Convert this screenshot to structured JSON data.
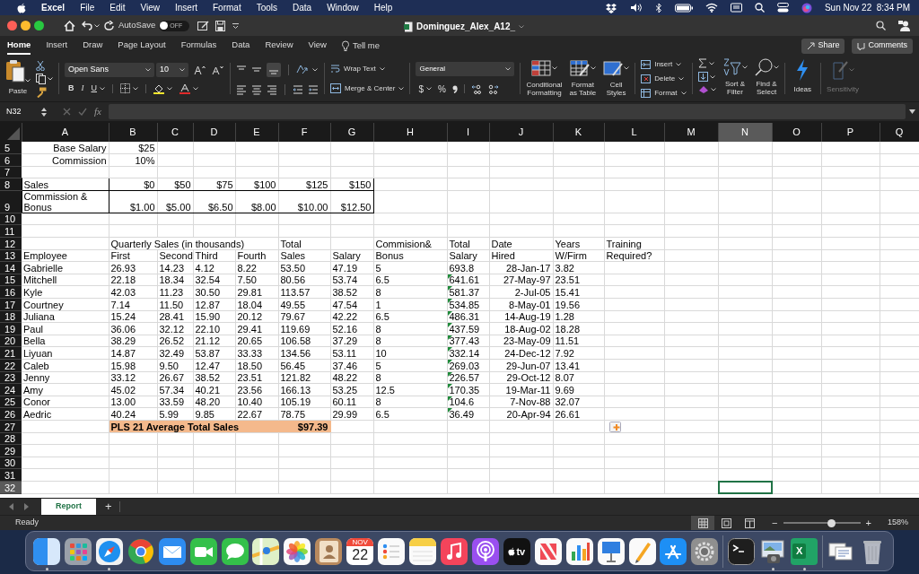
{
  "menu_bar": {
    "app": "Excel",
    "items": [
      "File",
      "Edit",
      "View",
      "Insert",
      "Format",
      "Tools",
      "Data",
      "Window",
      "Help"
    ],
    "clock": "Sun Nov 22  8:34 PM"
  },
  "title_bar": {
    "autosave": "AutoSave",
    "autosave_state": "OFF",
    "autosave_on": false,
    "document": "Dominguez_Alex_A12_"
  },
  "ribbon_tabs": [
    {
      "label": "Home",
      "selected": true
    },
    {
      "label": "Insert",
      "selected": false
    },
    {
      "label": "Draw",
      "selected": false
    },
    {
      "label": "Page Layout",
      "selected": false
    },
    {
      "label": "Formulas",
      "selected": false
    },
    {
      "label": "Data",
      "selected": false
    },
    {
      "label": "Review",
      "selected": false
    },
    {
      "label": "View",
      "selected": false
    }
  ],
  "tell_me": "Tell me",
  "share": "Share",
  "comments": "Comments",
  "ribbon": {
    "paste": "Paste",
    "font": "Open Sans",
    "size": "10",
    "bold": "B",
    "italic": "I",
    "underline": "U",
    "wrap": "Wrap Text",
    "merge": "Merge & Center",
    "number_format": "General",
    "currency": "$",
    "percent": "%",
    "styles": [
      "Conditional\nFormatting",
      "Format\nas Table",
      "Cell\nStyles"
    ],
    "cells": [
      "Insert",
      "Delete",
      "Format"
    ],
    "sort": "Sort &\nFilter",
    "find": "Find &\nSelect",
    "ideas": "Ideas",
    "sensitivity": "Sensitivity",
    "sensitivity_disabled": true
  },
  "formula_bar": {
    "name_box": "N32",
    "fx": "fx"
  },
  "columns": [
    {
      "label": "A",
      "selected": false
    },
    {
      "label": "B",
      "selected": false
    },
    {
      "label": "C",
      "selected": false
    },
    {
      "label": "D",
      "selected": false
    },
    {
      "label": "E",
      "selected": false
    },
    {
      "label": "F",
      "selected": false
    },
    {
      "label": "G",
      "selected": false
    },
    {
      "label": "H",
      "selected": false
    },
    {
      "label": "I",
      "selected": false
    },
    {
      "label": "J",
      "selected": false
    },
    {
      "label": "K",
      "selected": false
    },
    {
      "label": "L",
      "selected": false
    },
    {
      "label": "M",
      "selected": false
    },
    {
      "label": "N",
      "selected": true
    },
    {
      "label": "O",
      "selected": false
    },
    {
      "label": "P",
      "selected": false
    },
    {
      "label": "Q",
      "selected": false
    }
  ],
  "rows": [
    {
      "number": "5",
      "selected": false,
      "kind": "plain",
      "cells": [
        {
          "text": "Base Salary",
          "kind": "number"
        },
        {
          "text": "$25",
          "kind": "number"
        }
      ]
    },
    {
      "number": "6",
      "selected": false,
      "kind": "plain",
      "cells": [
        {
          "text": "Commission",
          "kind": "number"
        },
        {
          "text": "10%",
          "kind": "number"
        }
      ]
    },
    {
      "number": "7",
      "selected": false,
      "kind": "plain"
    },
    {
      "number": "8",
      "selected": false,
      "kind": "boxed",
      "cells": [
        "Sales",
        {
          "text": "$0",
          "kind": "number"
        },
        {
          "text": "$50",
          "kind": "number"
        },
        {
          "text": "$75",
          "kind": "number"
        },
        {
          "text": "$100",
          "kind": "number"
        },
        {
          "text": "$125",
          "kind": "number"
        },
        {
          "text": "$150",
          "kind": "number"
        }
      ]
    },
    {
      "number": "9",
      "selected": false,
      "kind": "boxed",
      "cells": [
        "Commission &\nBonus",
        {
          "text": "$1.00",
          "kind": "number"
        },
        {
          "text": "$5.00",
          "kind": "number"
        },
        {
          "text": "$6.50",
          "kind": "number"
        },
        {
          "text": "$8.00",
          "kind": "number"
        },
        {
          "text": "$10.00",
          "kind": "number"
        },
        {
          "text": "$12.50",
          "kind": "number"
        }
      ]
    },
    {
      "number": "10",
      "selected": false,
      "kind": "plain"
    },
    {
      "number": "11",
      "selected": false,
      "kind": "plain"
    },
    {
      "number": "12",
      "selected": false,
      "kind": "plain",
      "cells": [
        null,
        "Quarterly Sales (in thousands)",
        null,
        null,
        null,
        "Total",
        null,
        "Commision&",
        "Total",
        "Date",
        "Years",
        "Training"
      ]
    },
    {
      "number": "13",
      "selected": false,
      "kind": "plain",
      "cells": [
        "Employee",
        "First",
        "Second",
        "Third",
        "Fourth",
        "Sales",
        "Salary",
        "Bonus",
        "Salary",
        "Hired",
        "W/Firm",
        "Required?"
      ]
    },
    {
      "number": "14",
      "selected": false,
      "kind": "plain",
      "cells": [
        "Gabrielle",
        "26.93",
        "14.23",
        "4.12",
        "8.22",
        "53.50",
        "47.19",
        "5",
        "693.8",
        {
          "text": "28-Jan-17",
          "kind": "number"
        },
        "3.82"
      ]
    },
    {
      "number": "15",
      "selected": false,
      "kind": "plain",
      "cells": [
        "Mitchell",
        "22.18",
        "18.34",
        "32.54",
        "7.50",
        "80.56",
        "53.74",
        "6.5",
        {
          "text": "641.61",
          "kind": "warning"
        },
        {
          "text": "27-May-97",
          "kind": "number"
        },
        "23.51"
      ]
    },
    {
      "number": "16",
      "selected": false,
      "kind": "plain",
      "cells": [
        "Kyle",
        "42.03",
        "11.23",
        "30.50",
        "29.81",
        "113.57",
        "38.52",
        "8",
        {
          "text": "581.37",
          "kind": "warning"
        },
        {
          "text": "2-Jul-05",
          "kind": "number"
        },
        "15.41"
      ]
    },
    {
      "number": "17",
      "selected": false,
      "kind": "plain",
      "cells": [
        "Courtney",
        "7.14",
        "11.50",
        "12.87",
        "18.04",
        "49.55",
        "47.54",
        "1",
        {
          "text": "534.85",
          "kind": "warning"
        },
        {
          "text": "8-May-01",
          "kind": "number"
        },
        "19.56"
      ]
    },
    {
      "number": "18",
      "selected": false,
      "kind": "plain",
      "cells": [
        "Juliana",
        "15.24",
        "28.41",
        "15.90",
        "20.12",
        "79.67",
        "42.22",
        "6.5",
        {
          "text": "486.31",
          "kind": "warning"
        },
        {
          "text": "14-Aug-19",
          "kind": "number"
        },
        "1.28"
      ]
    },
    {
      "number": "19",
      "selected": false,
      "kind": "plain",
      "cells": [
        "Paul",
        "36.06",
        "32.12",
        "22.10",
        "29.41",
        "119.69",
        "52.16",
        "8",
        {
          "text": "437.59",
          "kind": "warning"
        },
        {
          "text": "18-Aug-02",
          "kind": "number"
        },
        "18.28"
      ]
    },
    {
      "number": "20",
      "selected": false,
      "kind": "plain",
      "cells": [
        "Bella",
        "38.29",
        "26.52",
        "21.12",
        "20.65",
        "106.58",
        "37.29",
        "8",
        {
          "text": "377.43",
          "kind": "warning"
        },
        {
          "text": "23-May-09",
          "kind": "number"
        },
        "11.51"
      ]
    },
    {
      "number": "21",
      "selected": false,
      "kind": "plain",
      "cells": [
        "Liyuan",
        "14.87",
        "32.49",
        "53.87",
        "33.33",
        "134.56",
        "53.11",
        "10",
        {
          "text": "332.14",
          "kind": "warning"
        },
        {
          "text": "24-Dec-12",
          "kind": "number"
        },
        "7.92"
      ]
    },
    {
      "number": "22",
      "selected": false,
      "kind": "plain",
      "cells": [
        "Caleb",
        "15.98",
        "9.50",
        "12.47",
        "18.50",
        "56.45",
        "37.46",
        "5",
        {
          "text": "269.03",
          "kind": "warning"
        },
        {
          "text": "29-Jun-07",
          "kind": "number"
        },
        "13.41"
      ]
    },
    {
      "number": "23",
      "selected": false,
      "kind": "plain",
      "cells": [
        "Jenny",
        "33.12",
        "26.67",
        "38.52",
        "23.51",
        "121.82",
        "48.22",
        "8",
        {
          "text": "226.57",
          "kind": "warning"
        },
        {
          "text": "29-Oct-12",
          "kind": "number"
        },
        "8.07"
      ]
    },
    {
      "number": "24",
      "selected": false,
      "kind": "plain",
      "cells": [
        "Amy",
        "45.02",
        "57.34",
        "40.21",
        "23.56",
        "166.13",
        "53.25",
        "12.5",
        {
          "text": "170.35",
          "kind": "warning"
        },
        {
          "text": "19-Mar-11",
          "kind": "number"
        },
        "9.69"
      ]
    },
    {
      "number": "25",
      "selected": false,
      "kind": "plain",
      "cells": [
        "Conor",
        "13.00",
        "33.59",
        "48.20",
        "10.40",
        "105.19",
        "60.11",
        "8",
        {
          "text": "104.6",
          "kind": "warning"
        },
        {
          "text": "7-Nov-88",
          "kind": "number"
        },
        "32.07"
      ]
    },
    {
      "number": "26",
      "selected": false,
      "kind": "plain",
      "cells": [
        "Aedric",
        "40.24",
        "5.99",
        "9.85",
        "22.67",
        "78.75",
        "29.99",
        "6.5",
        {
          "text": "36.49",
          "kind": "warning"
        },
        {
          "text": "20-Apr-94",
          "kind": "number"
        },
        "26.61"
      ]
    },
    {
      "number": "27",
      "selected": false,
      "kind": "total",
      "cells": [
        null,
        "PLS 21 Average Total Sales",
        null,
        null,
        null,
        {
          "text": "$97.39",
          "kind": "number"
        },
        null,
        null,
        null,
        null,
        null,
        {
          "kind": "paste-options"
        }
      ]
    },
    {
      "number": "28",
      "selected": false,
      "kind": "plain"
    },
    {
      "number": "29",
      "selected": false,
      "kind": "plain"
    },
    {
      "number": "30",
      "selected": false,
      "kind": "plain"
    },
    {
      "number": "31",
      "selected": false,
      "kind": "plain"
    },
    {
      "number": "32",
      "selected": true,
      "kind": "plain",
      "cells": [
        null,
        null,
        null,
        null,
        null,
        null,
        null,
        null,
        null,
        null,
        null,
        null,
        null,
        {
          "kind": "selected"
        }
      ]
    }
  ],
  "sheet_tabs": [
    {
      "label": "Report",
      "selected": true
    }
  ],
  "add_sheet": "+",
  "status": "Ready",
  "views": [
    {
      "selected": true
    },
    {
      "selected": false
    },
    {
      "selected": false
    }
  ],
  "zoom": {
    "out": "−",
    "in": "+",
    "level": 0.63,
    "reading": "158%"
  },
  "dock": [
    {
      "kind": "finder",
      "running": true
    },
    {
      "kind": "launchpad",
      "running": false
    },
    {
      "kind": "safari",
      "running": true
    },
    {
      "kind": "chrome",
      "running": false
    },
    {
      "kind": "mail",
      "running": false
    },
    {
      "kind": "facetime",
      "running": false
    },
    {
      "kind": "messages",
      "running": false
    },
    {
      "kind": "maps",
      "running": false
    },
    {
      "kind": "photos",
      "running": false
    },
    {
      "kind": "contacts",
      "running": false
    },
    {
      "kind": "calendar",
      "running": false,
      "month": "NOV",
      "day": "22"
    },
    {
      "kind": "reminders",
      "running": false
    },
    {
      "kind": "notes",
      "running": false
    },
    {
      "kind": "music",
      "running": false
    },
    {
      "kind": "podcasts",
      "running": false
    },
    {
      "kind": "tv",
      "running": false,
      "label": "tv"
    },
    {
      "kind": "news",
      "running": false
    },
    {
      "kind": "numbers",
      "running": false
    },
    {
      "kind": "keynote",
      "running": false
    },
    {
      "kind": "pages",
      "running": false
    },
    {
      "kind": "appstore",
      "running": false
    },
    {
      "kind": "settings",
      "running": false
    },
    {
      "kind": "separator"
    },
    {
      "kind": "terminal",
      "running": false
    },
    {
      "kind": "preview",
      "running": true
    },
    {
      "kind": "excel",
      "running": true,
      "label": "X"
    },
    {
      "kind": "separator"
    },
    {
      "kind": "documents",
      "running": false
    },
    {
      "kind": "trash",
      "running": false
    }
  ]
}
